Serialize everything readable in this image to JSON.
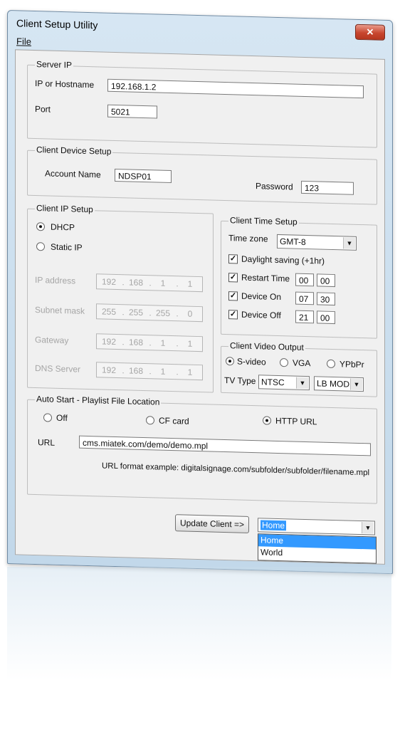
{
  "window": {
    "title": "Client Setup Utility",
    "close_glyph": "✕"
  },
  "menu": {
    "file": "File"
  },
  "server_ip": {
    "legend": "Server IP",
    "ip_label": "IP or Hostname",
    "ip_value": "192.168.1.2",
    "port_label": "Port",
    "port_value": "5021"
  },
  "device_setup": {
    "legend": "Client Device Setup",
    "account_label": "Account Name",
    "account_value": "NDSP01",
    "password_label": "Password",
    "password_value": "123"
  },
  "ip_setup": {
    "legend": "Client IP Setup",
    "dhcp_label": "DHCP",
    "static_label": "Static IP",
    "mode": "DHCP",
    "fields": [
      {
        "label": "IP address",
        "octets": [
          "192",
          "168",
          "1",
          "1"
        ]
      },
      {
        "label": "Subnet mask",
        "octets": [
          "255",
          "255",
          "255",
          "0"
        ]
      },
      {
        "label": "Gateway",
        "octets": [
          "192",
          "168",
          "1",
          "1"
        ]
      },
      {
        "label": "DNS Server",
        "octets": [
          "192",
          "168",
          "1",
          "1"
        ]
      }
    ]
  },
  "time_setup": {
    "legend": "Client Time Setup",
    "timezone_label": "Time zone",
    "timezone_value": "GMT-8",
    "daylight_label": "Daylight saving (+1hr)",
    "daylight_checked": true,
    "restart_label": "Restart Time",
    "restart_h": "00",
    "restart_m": "00",
    "on_label": "Device On",
    "on_h": "07",
    "on_m": "30",
    "off_label": "Device Off",
    "off_h": "21",
    "off_m": "00",
    "check_mark": "✓"
  },
  "video_output": {
    "legend": "Client Video Output",
    "svideo_label": "S-video",
    "vga_label": "VGA",
    "ypbpr_label": "YPbPr",
    "selected": "S-video",
    "tvtype_label": "TV Type",
    "tvtype_value": "NTSC",
    "lbmode_value": "LB MODE"
  },
  "autostart": {
    "legend": "Auto Start - Playlist File Location",
    "off_label": "Off",
    "cf_label": "CF card",
    "http_label": "HTTP URL",
    "selected": "HTTP URL",
    "url_label": "URL",
    "url_value": "cms.miatek.com/demo/demo.mpl",
    "example": "URL format example: digitalsignage.com/subfolder/subfolder/filename.mpl"
  },
  "footer": {
    "update_button": "Update Client =>",
    "target_value": "Home",
    "dropdown_options": [
      "Home",
      "World"
    ]
  }
}
